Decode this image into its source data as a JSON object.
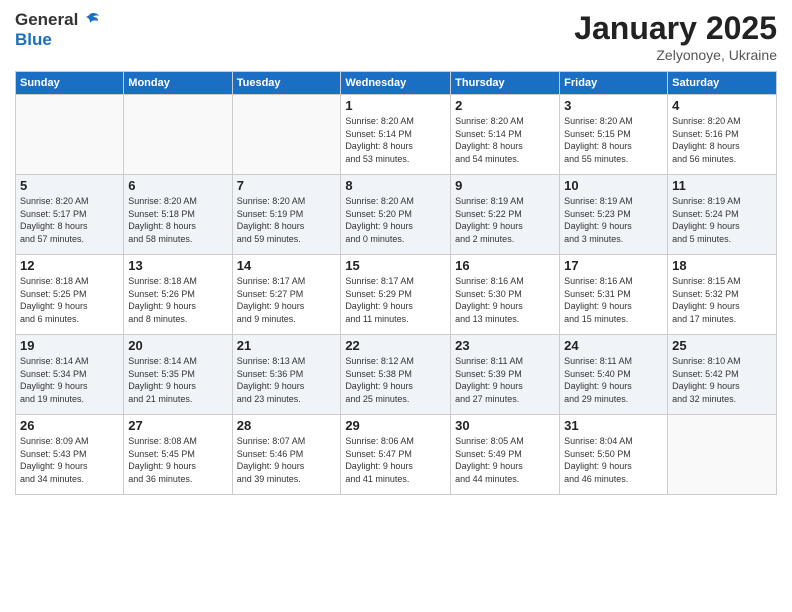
{
  "header": {
    "logo_line1": "General",
    "logo_line2": "Blue",
    "month": "January 2025",
    "location": "Zelyonoye, Ukraine"
  },
  "weekdays": [
    "Sunday",
    "Monday",
    "Tuesday",
    "Wednesday",
    "Thursday",
    "Friday",
    "Saturday"
  ],
  "weeks": [
    [
      {
        "day": "",
        "info": ""
      },
      {
        "day": "",
        "info": ""
      },
      {
        "day": "",
        "info": ""
      },
      {
        "day": "1",
        "info": "Sunrise: 8:20 AM\nSunset: 5:14 PM\nDaylight: 8 hours\nand 53 minutes."
      },
      {
        "day": "2",
        "info": "Sunrise: 8:20 AM\nSunset: 5:14 PM\nDaylight: 8 hours\nand 54 minutes."
      },
      {
        "day": "3",
        "info": "Sunrise: 8:20 AM\nSunset: 5:15 PM\nDaylight: 8 hours\nand 55 minutes."
      },
      {
        "day": "4",
        "info": "Sunrise: 8:20 AM\nSunset: 5:16 PM\nDaylight: 8 hours\nand 56 minutes."
      }
    ],
    [
      {
        "day": "5",
        "info": "Sunrise: 8:20 AM\nSunset: 5:17 PM\nDaylight: 8 hours\nand 57 minutes."
      },
      {
        "day": "6",
        "info": "Sunrise: 8:20 AM\nSunset: 5:18 PM\nDaylight: 8 hours\nand 58 minutes."
      },
      {
        "day": "7",
        "info": "Sunrise: 8:20 AM\nSunset: 5:19 PM\nDaylight: 8 hours\nand 59 minutes."
      },
      {
        "day": "8",
        "info": "Sunrise: 8:20 AM\nSunset: 5:20 PM\nDaylight: 9 hours\nand 0 minutes."
      },
      {
        "day": "9",
        "info": "Sunrise: 8:19 AM\nSunset: 5:22 PM\nDaylight: 9 hours\nand 2 minutes."
      },
      {
        "day": "10",
        "info": "Sunrise: 8:19 AM\nSunset: 5:23 PM\nDaylight: 9 hours\nand 3 minutes."
      },
      {
        "day": "11",
        "info": "Sunrise: 8:19 AM\nSunset: 5:24 PM\nDaylight: 9 hours\nand 5 minutes."
      }
    ],
    [
      {
        "day": "12",
        "info": "Sunrise: 8:18 AM\nSunset: 5:25 PM\nDaylight: 9 hours\nand 6 minutes."
      },
      {
        "day": "13",
        "info": "Sunrise: 8:18 AM\nSunset: 5:26 PM\nDaylight: 9 hours\nand 8 minutes."
      },
      {
        "day": "14",
        "info": "Sunrise: 8:17 AM\nSunset: 5:27 PM\nDaylight: 9 hours\nand 9 minutes."
      },
      {
        "day": "15",
        "info": "Sunrise: 8:17 AM\nSunset: 5:29 PM\nDaylight: 9 hours\nand 11 minutes."
      },
      {
        "day": "16",
        "info": "Sunrise: 8:16 AM\nSunset: 5:30 PM\nDaylight: 9 hours\nand 13 minutes."
      },
      {
        "day": "17",
        "info": "Sunrise: 8:16 AM\nSunset: 5:31 PM\nDaylight: 9 hours\nand 15 minutes."
      },
      {
        "day": "18",
        "info": "Sunrise: 8:15 AM\nSunset: 5:32 PM\nDaylight: 9 hours\nand 17 minutes."
      }
    ],
    [
      {
        "day": "19",
        "info": "Sunrise: 8:14 AM\nSunset: 5:34 PM\nDaylight: 9 hours\nand 19 minutes."
      },
      {
        "day": "20",
        "info": "Sunrise: 8:14 AM\nSunset: 5:35 PM\nDaylight: 9 hours\nand 21 minutes."
      },
      {
        "day": "21",
        "info": "Sunrise: 8:13 AM\nSunset: 5:36 PM\nDaylight: 9 hours\nand 23 minutes."
      },
      {
        "day": "22",
        "info": "Sunrise: 8:12 AM\nSunset: 5:38 PM\nDaylight: 9 hours\nand 25 minutes."
      },
      {
        "day": "23",
        "info": "Sunrise: 8:11 AM\nSunset: 5:39 PM\nDaylight: 9 hours\nand 27 minutes."
      },
      {
        "day": "24",
        "info": "Sunrise: 8:11 AM\nSunset: 5:40 PM\nDaylight: 9 hours\nand 29 minutes."
      },
      {
        "day": "25",
        "info": "Sunrise: 8:10 AM\nSunset: 5:42 PM\nDaylight: 9 hours\nand 32 minutes."
      }
    ],
    [
      {
        "day": "26",
        "info": "Sunrise: 8:09 AM\nSunset: 5:43 PM\nDaylight: 9 hours\nand 34 minutes."
      },
      {
        "day": "27",
        "info": "Sunrise: 8:08 AM\nSunset: 5:45 PM\nDaylight: 9 hours\nand 36 minutes."
      },
      {
        "day": "28",
        "info": "Sunrise: 8:07 AM\nSunset: 5:46 PM\nDaylight: 9 hours\nand 39 minutes."
      },
      {
        "day": "29",
        "info": "Sunrise: 8:06 AM\nSunset: 5:47 PM\nDaylight: 9 hours\nand 41 minutes."
      },
      {
        "day": "30",
        "info": "Sunrise: 8:05 AM\nSunset: 5:49 PM\nDaylight: 9 hours\nand 44 minutes."
      },
      {
        "day": "31",
        "info": "Sunrise: 8:04 AM\nSunset: 5:50 PM\nDaylight: 9 hours\nand 46 minutes."
      },
      {
        "day": "",
        "info": ""
      }
    ]
  ]
}
